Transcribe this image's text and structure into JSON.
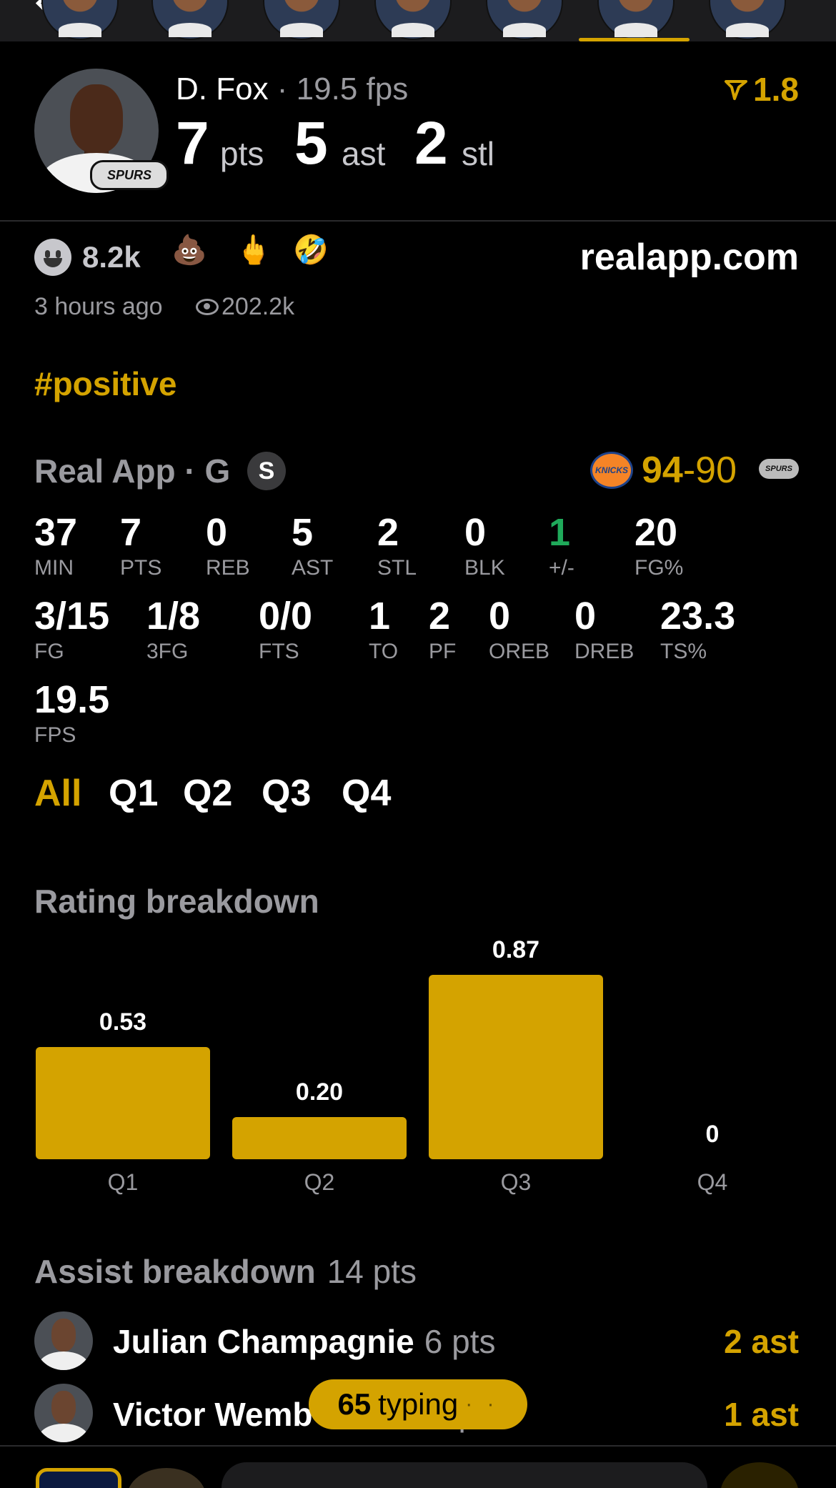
{
  "player": {
    "name": "D. Fox",
    "fps_label": " · 19.5 fps",
    "rating": "1.8",
    "team_badge": "SPURS",
    "headline": [
      {
        "value": "7",
        "unit": "pts"
      },
      {
        "value": "5",
        "unit": "ast"
      },
      {
        "value": "2",
        "unit": "stl"
      }
    ]
  },
  "reactions": {
    "smiley_count": "8.2k",
    "emojis": [
      "💩",
      "🖕",
      "🤣"
    ],
    "source": "realapp.com",
    "time_ago": "3 hours ago",
    "views": "202.2k"
  },
  "hashtag": "#positive",
  "game": {
    "label": "Real App · G",
    "badge": "S",
    "home_logo": "KNICKS",
    "score_team": "94",
    "score_sep": "-",
    "score_opp": "90",
    "away_logo": "SPURS"
  },
  "stats_row1": [
    {
      "value": "37",
      "label": "MIN"
    },
    {
      "value": "7",
      "label": "PTS"
    },
    {
      "value": "0",
      "label": "REB"
    },
    {
      "value": "5",
      "label": "AST"
    },
    {
      "value": "2",
      "label": "STL"
    },
    {
      "value": "0",
      "label": "BLK"
    },
    {
      "value": "1",
      "label": "+/-"
    },
    {
      "value": "20",
      "label": "FG%"
    }
  ],
  "stats_row2": [
    {
      "value": "3/15",
      "label": "FG"
    },
    {
      "value": "1/8",
      "label": "3FG"
    },
    {
      "value": "0/0",
      "label": "FTS"
    },
    {
      "value": "1",
      "label": "TO"
    },
    {
      "value": "2",
      "label": "PF"
    },
    {
      "value": "0",
      "label": "OREB"
    },
    {
      "value": "0",
      "label": "DREB"
    },
    {
      "value": "23.3",
      "label": "TS%"
    }
  ],
  "stats_row3": [
    {
      "value": "19.5",
      "label": "FPS"
    }
  ],
  "quarter_tabs": [
    "All",
    "Q1",
    "Q2",
    "Q3",
    "Q4"
  ],
  "colors": {
    "accent": "#d4a300",
    "positive": "#1faa5a",
    "muted": "#9a9a9f",
    "background": "#000000"
  },
  "rating_breakdown": {
    "title": "Rating breakdown"
  },
  "chart_data": {
    "type": "bar",
    "categories": [
      "Q1",
      "Q2",
      "Q3",
      "Q4"
    ],
    "values": [
      0.53,
      0.2,
      0.87,
      0
    ],
    "value_labels": [
      "0.53",
      "0.20",
      "0.87",
      "0"
    ],
    "title": "Rating breakdown",
    "xlabel": "",
    "ylabel": "",
    "ylim": [
      0,
      0.87
    ],
    "grid": false
  },
  "assist_breakdown": {
    "title": "Assist breakdown",
    "total": "14 pts",
    "rows": [
      {
        "name": "Julian Champagnie",
        "pts": "6 pts",
        "ast": "2 ast"
      },
      {
        "name": "Victor Wemb",
        "pts": "pts",
        "ast": "1 ast"
      }
    ]
  },
  "typing": {
    "count": "65",
    "label": "typing",
    "dots": "· ·"
  }
}
